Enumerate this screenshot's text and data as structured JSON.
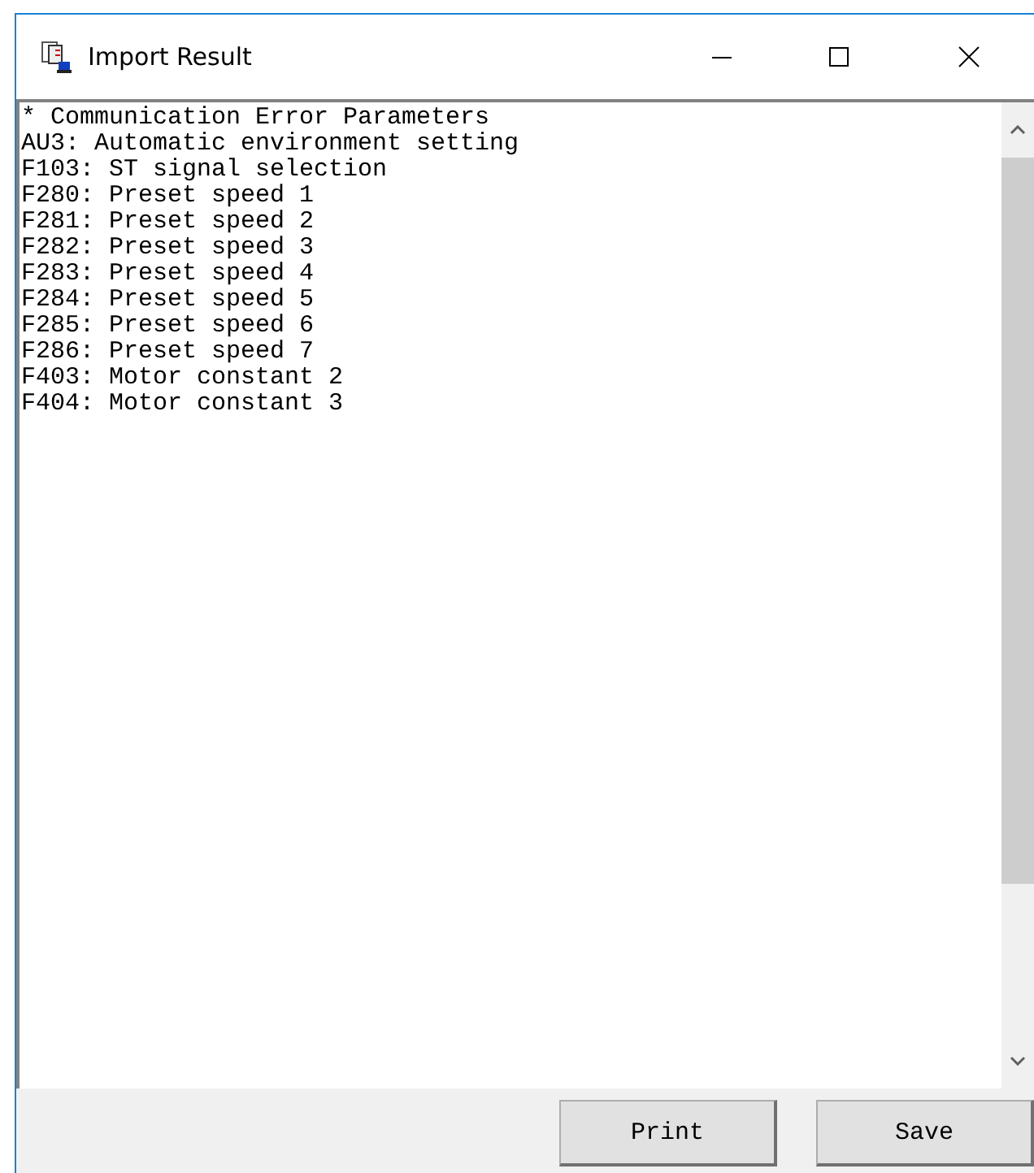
{
  "window": {
    "title": "Import Result"
  },
  "log_lines": [
    "* Communication Error Parameters",
    "AU3: Automatic environment setting",
    "F103: ST signal selection",
    "F280: Preset speed 1",
    "F281: Preset speed 2",
    "F282: Preset speed 3",
    "F283: Preset speed 4",
    "F284: Preset speed 5",
    "F285: Preset speed 6",
    "F286: Preset speed 7",
    "F403: Motor constant 2",
    "F404: Motor constant 3"
  ],
  "buttons": [
    {
      "label": "Print"
    },
    {
      "label": "Save"
    }
  ]
}
